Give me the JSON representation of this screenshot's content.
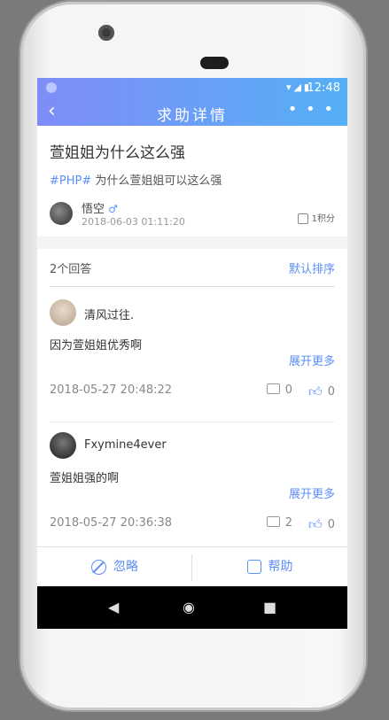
{
  "status": {
    "time": "12:48",
    "icons": "▾◢▮"
  },
  "nav": {
    "back_icon": "‹",
    "title": "求助详情",
    "more_icon": "• • •"
  },
  "question": {
    "title": "萱姐姐为什么这么强",
    "tag": "#PHP#",
    "desc": " 为什么萱姐姐可以这么强",
    "user": "悟空",
    "gender": "♂",
    "time": "2018-06-03 01:11:20",
    "points": "1积分"
  },
  "answers": {
    "count_label": "2个回答",
    "sort_label": "默认排序",
    "items": [
      {
        "name": "清风过往.",
        "text": "因为萱姐姐优秀啊",
        "expand": "展开更多",
        "time": "2018-05-27 20:48:22",
        "comments": "0",
        "likes": "0"
      },
      {
        "name": "Fxymine4ever",
        "text": "萱姐姐强的啊",
        "expand": "展开更多",
        "time": "2018-05-27 20:36:38",
        "comments": "2",
        "likes": "0"
      }
    ]
  },
  "bottom": {
    "ignore_label": "忽略",
    "help_label": "帮助"
  },
  "system_nav": {
    "back": "◀",
    "home": "◉",
    "recent": "■"
  }
}
